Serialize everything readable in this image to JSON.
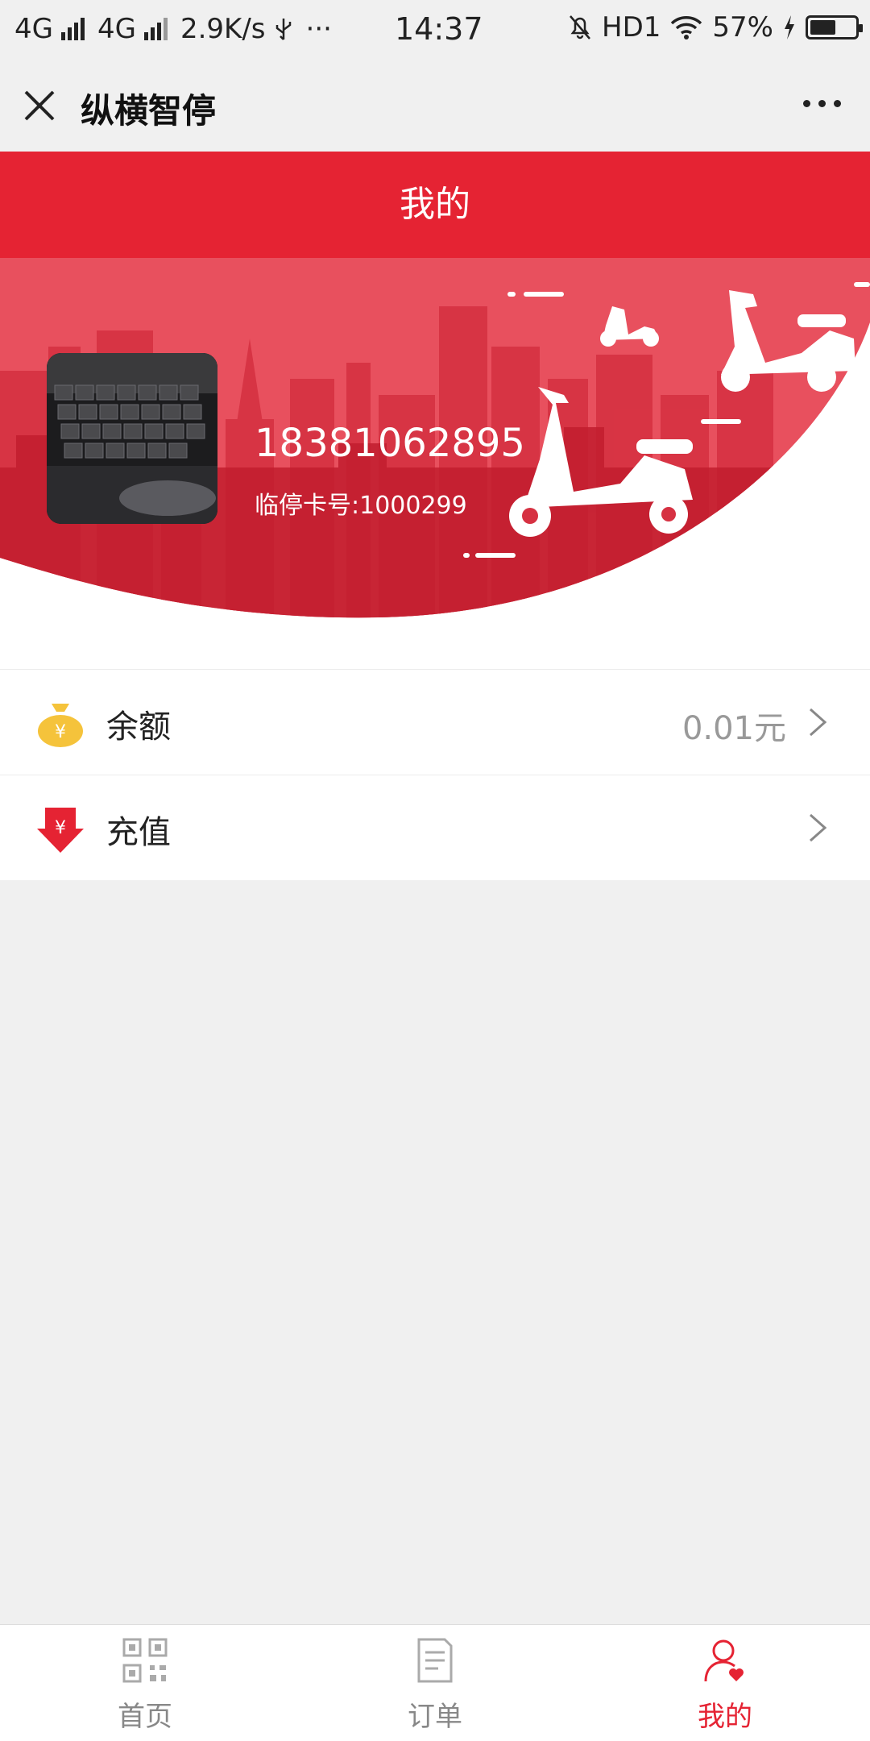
{
  "status_bar": {
    "network1": "4G",
    "network2": "4G",
    "speed": "2.9K/s",
    "dots": "···",
    "time": "14:37",
    "hd": "HD1",
    "battery_pct": "57%",
    "battery_level": 0.57
  },
  "title_bar": {
    "app_title": "纵横智停"
  },
  "page_header": {
    "title": "我的"
  },
  "profile": {
    "phone": "18381062895",
    "card_number": "临停卡号:1000299"
  },
  "menu": {
    "items": [
      {
        "label": "余额",
        "value": "0.01元",
        "icon": "money-bag-icon"
      },
      {
        "label": "充值",
        "value": "",
        "icon": "recharge-arrow-icon"
      }
    ]
  },
  "tabs": [
    {
      "label": "首页",
      "icon": "qr-code-icon",
      "active": false
    },
    {
      "label": "订单",
      "icon": "order-list-icon",
      "active": false
    },
    {
      "label": "我的",
      "icon": "user-heart-icon",
      "active": true
    }
  ],
  "colors": {
    "brand_red": "#e52333",
    "gray_text": "#999999"
  }
}
